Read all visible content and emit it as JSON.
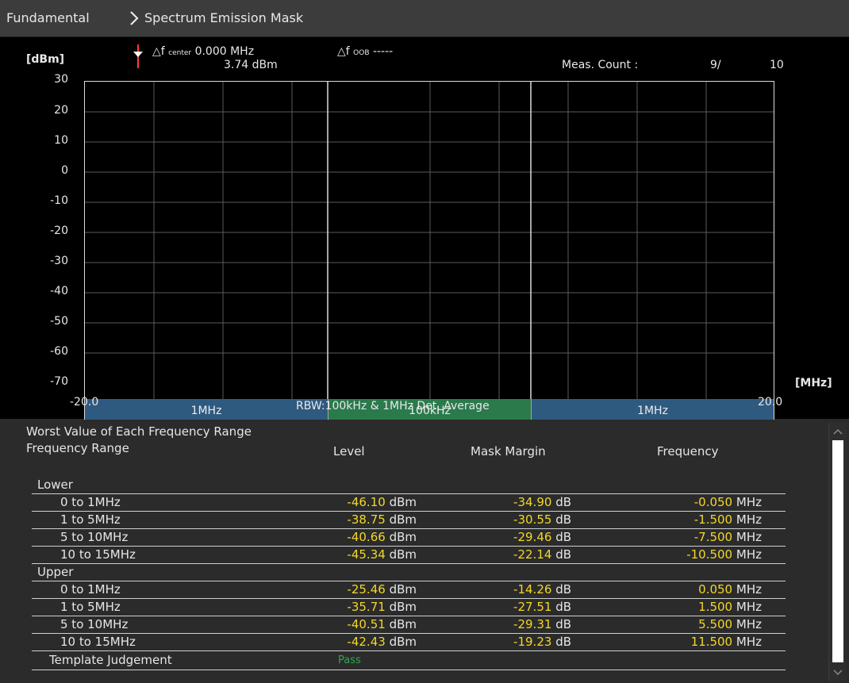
{
  "titlebar": {
    "crumb1": "Fundamental",
    "crumb2": "Spectrum Emission Mask"
  },
  "graph": {
    "y_unit": "[dBm]",
    "x_unit": "[MHz]",
    "marker_center_prefix": "△f",
    "marker_center_sub": "center",
    "marker_center_freq": "0.000 MHz",
    "marker_level": "3.74 dBm",
    "marker_oob_prefix": "△f",
    "marker_oob_sub": "OOB",
    "marker_oob_value": "-----",
    "meas_label": "Meas. Count :",
    "meas_current": "9/",
    "meas_total": "10",
    "y_ticks": [
      "30",
      "20",
      "10",
      "0",
      "-10",
      "-20",
      "-30",
      "-40",
      "-50",
      "-60",
      "-70"
    ],
    "x_min_label": "-20.0",
    "x_max_label": "20.0",
    "footer": "RBW:100kHz & 1MHz Det. Average",
    "bands": [
      {
        "label": "1MHz",
        "color": "#2f5a80"
      },
      {
        "label": "100kHz",
        "color": "#2a7a4c"
      },
      {
        "label": "1MHz",
        "color": "#2f5a80"
      }
    ],
    "colors": {
      "marker": "#ff3b3b",
      "grid": "#5a5a5a",
      "frame": "#dcdcdc"
    }
  },
  "table": {
    "section_title": "Worst Value of Each Frequency Range",
    "headers": {
      "range": "Frequency Range",
      "level": "Level",
      "margin": "Mask Margin",
      "freq": "Frequency"
    },
    "lower_label": "Lower",
    "upper_label": "Upper",
    "lower": [
      {
        "range": "0 to 1MHz",
        "level": "-46.10",
        "level_unit": "dBm",
        "margin": "-34.90",
        "margin_unit": "dB",
        "freq": "-0.050",
        "freq_unit": "MHz"
      },
      {
        "range": "1 to 5MHz",
        "level": "-38.75",
        "level_unit": "dBm",
        "margin": "-30.55",
        "margin_unit": "dB",
        "freq": "-1.500",
        "freq_unit": "MHz"
      },
      {
        "range": "5 to 10MHz",
        "level": "-40.66",
        "level_unit": "dBm",
        "margin": "-29.46",
        "margin_unit": "dB",
        "freq": "-7.500",
        "freq_unit": "MHz"
      },
      {
        "range": "10 to 15MHz",
        "level": "-45.34",
        "level_unit": "dBm",
        "margin": "-22.14",
        "margin_unit": "dB",
        "freq": "-10.500",
        "freq_unit": "MHz"
      }
    ],
    "upper": [
      {
        "range": "0 to 1MHz",
        "level": "-25.46",
        "level_unit": "dBm",
        "margin": "-14.26",
        "margin_unit": "dB",
        "freq": "0.050",
        "freq_unit": "MHz"
      },
      {
        "range": "1 to 5MHz",
        "level": "-35.71",
        "level_unit": "dBm",
        "margin": "-27.51",
        "margin_unit": "dB",
        "freq": "1.500",
        "freq_unit": "MHz"
      },
      {
        "range": "5 to 10MHz",
        "level": "-40.51",
        "level_unit": "dBm",
        "margin": "-29.31",
        "margin_unit": "dB",
        "freq": "5.500",
        "freq_unit": "MHz"
      },
      {
        "range": "10 to 15MHz",
        "level": "-42.43",
        "level_unit": "dBm",
        "margin": "-19.23",
        "margin_unit": "dB",
        "freq": "11.500",
        "freq_unit": "MHz"
      }
    ],
    "judgement_label": "Template Judgement",
    "judgement_value": "Pass",
    "colors": {
      "value": "#f2d72a",
      "pass": "#2fa84f"
    }
  }
}
